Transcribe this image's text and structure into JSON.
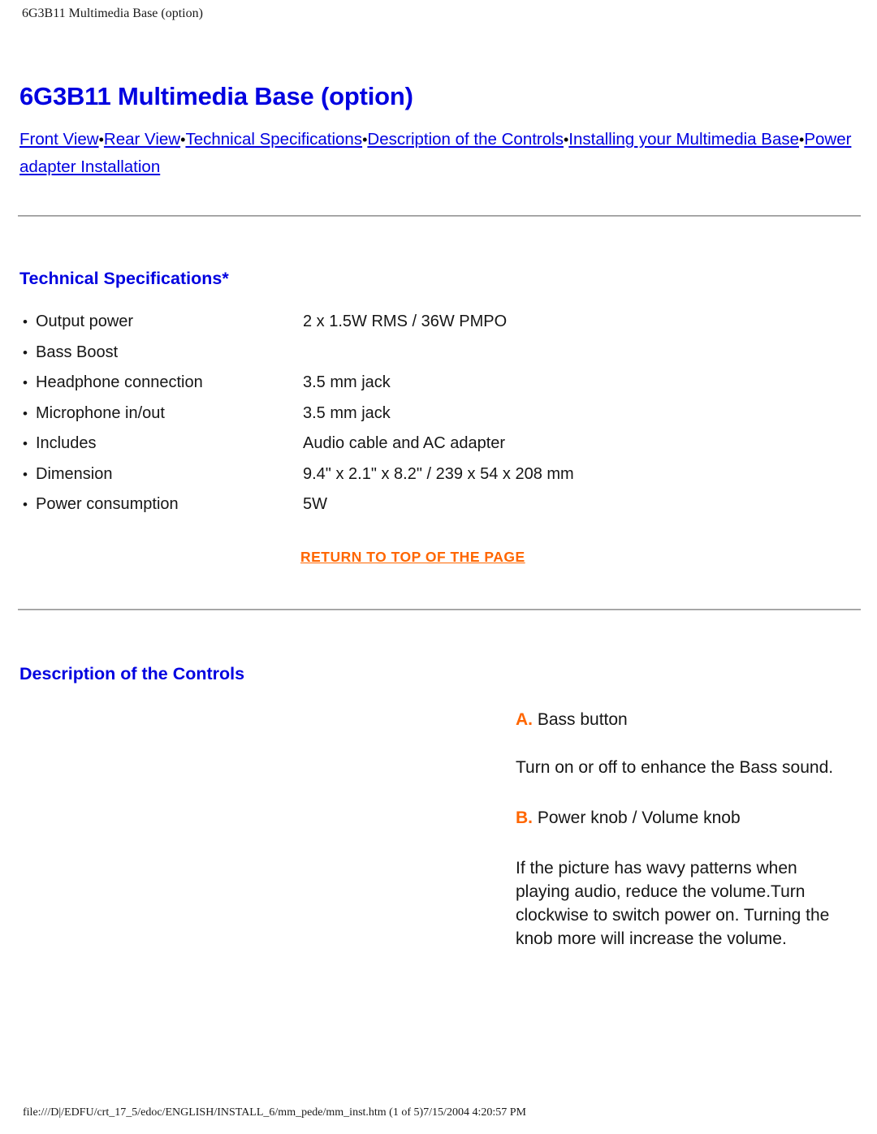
{
  "page": {
    "header_title": "6G3B11 Multimedia Base (option)",
    "doc_title": "6G3B11 Multimedia Base (option)",
    "footer": "file:///D|/EDFU/crt_17_5/edoc/ENGLISH/INSTALL_6/mm_pede/mm_inst.htm (1 of 5)7/15/2004 4:20:57 PM"
  },
  "colors": {
    "heading_blue": "#0000e0",
    "link_blue": "#0000e0",
    "accent_orange": "#ff6600",
    "rule_gray": "#b8b8b8",
    "text_black": "#161616"
  },
  "nav": {
    "separator": "•",
    "links": [
      {
        "label": "Front View"
      },
      {
        "label": "Rear View"
      },
      {
        "label": "Technical Specifications"
      },
      {
        "label": "Description of the Controls"
      },
      {
        "label": "Installing your Multimedia Base"
      },
      {
        "label": "Power adapter Installation"
      }
    ]
  },
  "tech_specs": {
    "heading": "Technical Specifications*",
    "bullet": "•",
    "rows": [
      {
        "label": "Output power",
        "value": "2 x 1.5W RMS / 36W PMPO"
      },
      {
        "label": "Bass Boost",
        "value": ""
      },
      {
        "label": "Headphone connection",
        "value": "3.5 mm jack"
      },
      {
        "label": "Microphone in/out",
        "value": "3.5 mm jack"
      },
      {
        "label": "Includes",
        "value": "Audio cable and AC adapter"
      },
      {
        "label": "Dimension",
        "value": "9.4\" x 2.1\" x 8.2\" / 239 x 54 x 208 mm"
      },
      {
        "label": "Power consumption",
        "value": "5W"
      }
    ]
  },
  "return_top": {
    "label": "RETURN TO TOP OF THE PAGE"
  },
  "controls": {
    "heading": "Description of the Controls",
    "items": [
      {
        "marker": "A.",
        "title": " Bass button"
      },
      {
        "marker": "",
        "title": "Turn on or off to enhance the Bass sound."
      },
      {
        "marker": "B.",
        "title": " Power knob / Volume knob"
      },
      {
        "marker": "",
        "title": "If the picture has wavy patterns when playing audio, reduce the volume.Turn clockwise to switch power on. Turning the knob more will increase the volume."
      }
    ]
  }
}
